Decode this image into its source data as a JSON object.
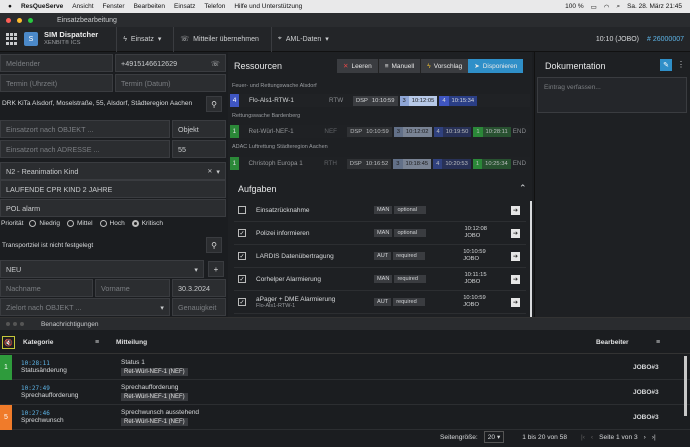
{
  "menubar": {
    "app": "ResQueServe",
    "items": [
      "Ansicht",
      "Fenster",
      "Bearbeiten",
      "Einsatz",
      "Telefon",
      "Hilfe und Unterstützung"
    ],
    "battery": "100 %",
    "datetime": "Sa. 28. März 21:45"
  },
  "window": {
    "title": "Einsatzbearbeitung"
  },
  "header": {
    "user_title": "SIM Dispatcher",
    "user_sub": "XENBIT® ICS",
    "avatar": "S",
    "einsatz": "Einsatz",
    "mitteiler": "Mitteiler übernehmen",
    "aml": "AML-Daten",
    "clock": "10:10 (JOBO)",
    "incident": "# 26000007"
  },
  "form": {
    "meldender_ph": "Meldender",
    "phone": "+4915146612629",
    "termin_uhrzeit_ph": "Termin (Uhrzeit)",
    "termin_datum_ph": "Termin (Datum)",
    "address": "DRK KiTa Alsdorf, Moselstraße, 55, Alsdorf, Städteregion Aachen",
    "einsatzort_objekt_ph": "Einsatzort nach OBJEKT ...",
    "objekt": "Objekt",
    "einsatzort_adresse_ph": "Einsatzort nach ADRESSE ...",
    "hausnummer": "55",
    "keyword": "N2 - Reanimation Kind",
    "note1": "LAUFENDE CPR KIND 2 JAHRE",
    "note2": "POL alarm",
    "prio_label": "Priorität",
    "prio_options": [
      "Niedrig",
      "Mittel",
      "Hoch",
      "Kritisch"
    ],
    "transport": "Transportziel ist nicht festgelegt",
    "status": "NEU",
    "nachname_ph": "Nachname",
    "vorname_ph": "Vorname",
    "date": "30.3.2024",
    "zielort_ph": "Zielort nach OBJEKT ...",
    "genauigkeit_ph": "Genauigkeit"
  },
  "ressourcen": {
    "title": "Ressourcen",
    "buttons": {
      "leeren": "Leeren",
      "manuell": "Manuell",
      "vorschlag": "Vorschlag",
      "disponieren": "Disponieren"
    },
    "groups": [
      {
        "name": "Feuer- und Rettungswache Alsdorf",
        "unit": {
          "status": "4",
          "name": "Flo-Als1-RTW-1",
          "type": "RTW",
          "chips": [
            {
              "k": "DSP",
              "t": "10:10:59"
            },
            {
              "k": "3",
              "t": "10:12:05"
            },
            {
              "k": "4",
              "t": "10:15:34"
            }
          ],
          "end": ""
        }
      },
      {
        "name": "Rettungswache Bardenberg",
        "unit": {
          "status": "1",
          "name": "Ret-Würl-NEF-1",
          "type": "NEF",
          "chips": [
            {
              "k": "DSP",
              "t": "10:10:59"
            },
            {
              "k": "3",
              "t": "10:12:02"
            },
            {
              "k": "4",
              "t": "10:19:50"
            },
            {
              "k": "1",
              "t": "10:28:11"
            }
          ],
          "end": "END"
        }
      },
      {
        "name": "ADAC Luftrettung Städteregion Aachen",
        "unit": {
          "status": "1",
          "name": "Christoph Europa 1",
          "type": "RTH",
          "chips": [
            {
              "k": "DSP",
              "t": "10:16:52"
            },
            {
              "k": "3",
              "t": "10:18:45"
            },
            {
              "k": "4",
              "t": "10:20:53"
            },
            {
              "k": "1",
              "t": "10:25:34"
            }
          ],
          "end": "END"
        }
      }
    ]
  },
  "aufgaben": {
    "title": "Aufgaben",
    "items": [
      {
        "checked": false,
        "name": "Einsatzrücknahme",
        "sub": "",
        "mode": "MAN",
        "req": "optional",
        "time": "",
        "by": ""
      },
      {
        "checked": true,
        "name": "Polizei informieren",
        "sub": "",
        "mode": "MAN",
        "req": "optional",
        "time": "10:12:08",
        "by": "JOBO"
      },
      {
        "checked": true,
        "name": "LARDIS Datenübertragung",
        "sub": "",
        "mode": "AUT",
        "req": "required",
        "time": "10:10:59",
        "by": "JOBO"
      },
      {
        "checked": true,
        "name": "Corhelper Alarmierung",
        "sub": "",
        "mode": "MAN",
        "req": "required",
        "time": "10:11:15",
        "by": "JOBO"
      },
      {
        "checked": true,
        "name": "aPager + DME Alarmierung",
        "sub": "Flo-Als1-RTW-1",
        "mode": "AUT",
        "req": "required",
        "time": "10:10:59",
        "by": "JOBO"
      }
    ]
  },
  "doku": {
    "title": "Dokumentation",
    "placeholder": "Eintrag verfassen..."
  },
  "notifications": {
    "title": "Benachrichtigungen",
    "cols": {
      "kategorie": "Kategorie",
      "mitteilung": "Mitteilung",
      "bearbeiter": "Bearbeiter"
    },
    "rows": [
      {
        "badge": "1",
        "badge_color": "#2e9b3c",
        "time": "10:28:11",
        "kategorie": "Statusänderung",
        "msg": "Status 1",
        "unit": "Ret-Würl-NEF-1 (NEF)",
        "by": "JOBO#3"
      },
      {
        "badge": "",
        "badge_color": "",
        "time": "10:27:49",
        "kategorie": "Sprechaufforderung",
        "msg": "Sprechaufforderung",
        "unit": "Ret-Würl-NEF-1 (NEF)",
        "by": "JOBO#3"
      },
      {
        "badge": "5",
        "badge_color": "#f07b2a",
        "time": "10:27:46",
        "kategorie": "Sprechwunsch",
        "msg": "Sprechwunsch ausstehend",
        "unit": "Ret-Würl-NEF-1 (NEF)",
        "by": "JOBO#3"
      }
    ],
    "footer": {
      "page_size_label": "Seitengröße:",
      "page_size": "20",
      "range": "1 bis 20 von 58",
      "page": "Seite 1 von 3"
    }
  }
}
